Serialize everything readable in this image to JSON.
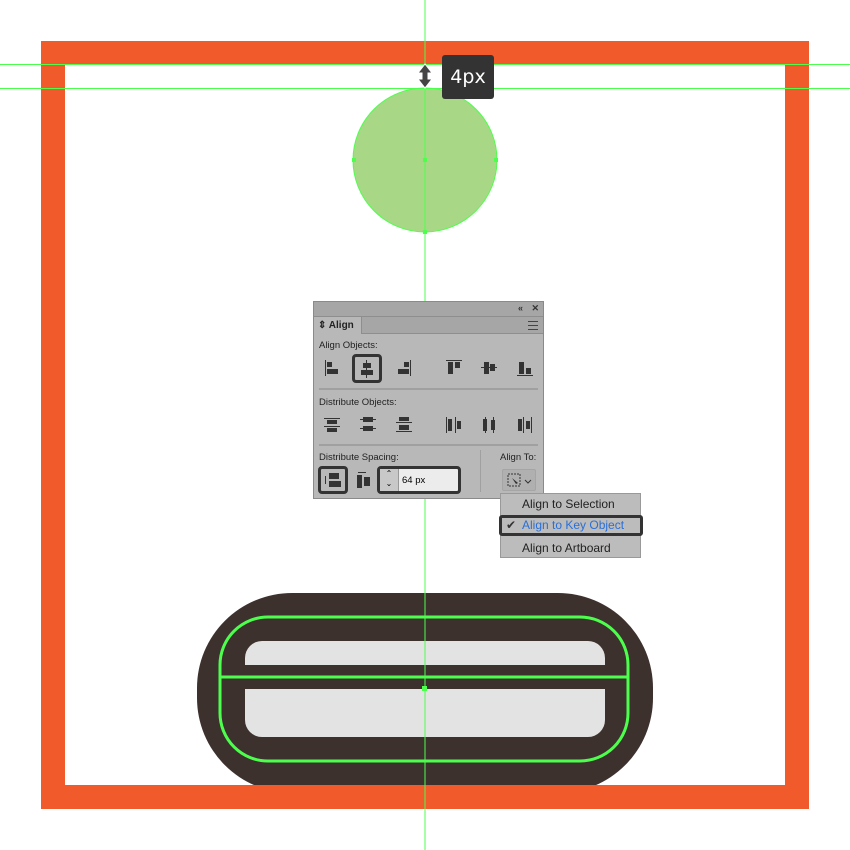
{
  "tooltip": {
    "text": "4px",
    "icon": "vertical-distance-arrows-icon"
  },
  "colors": {
    "frame": "#f15a2b",
    "guide": "#4cff4c",
    "circle": "#a8d886",
    "dark": "#3d312e",
    "light": "#e3e3e3",
    "panel": "#b8b8b8",
    "accent": "#2a6fd6"
  },
  "panel": {
    "tab_label": "Align",
    "align_objects_label": "Align Objects:",
    "distribute_objects_label": "Distribute Objects:",
    "distribute_spacing_label": "Distribute Spacing:",
    "align_to_label": "Align To:",
    "spacing_value": "64 px",
    "collapse_icon": "«",
    "close_icon": "✕"
  },
  "dropdown": {
    "items": [
      {
        "label": "Align to Selection",
        "checked": false
      },
      {
        "label": "Align to Key Object",
        "checked": true
      },
      {
        "label": "Align to Artboard",
        "checked": false
      }
    ],
    "check_mark": "✔"
  }
}
